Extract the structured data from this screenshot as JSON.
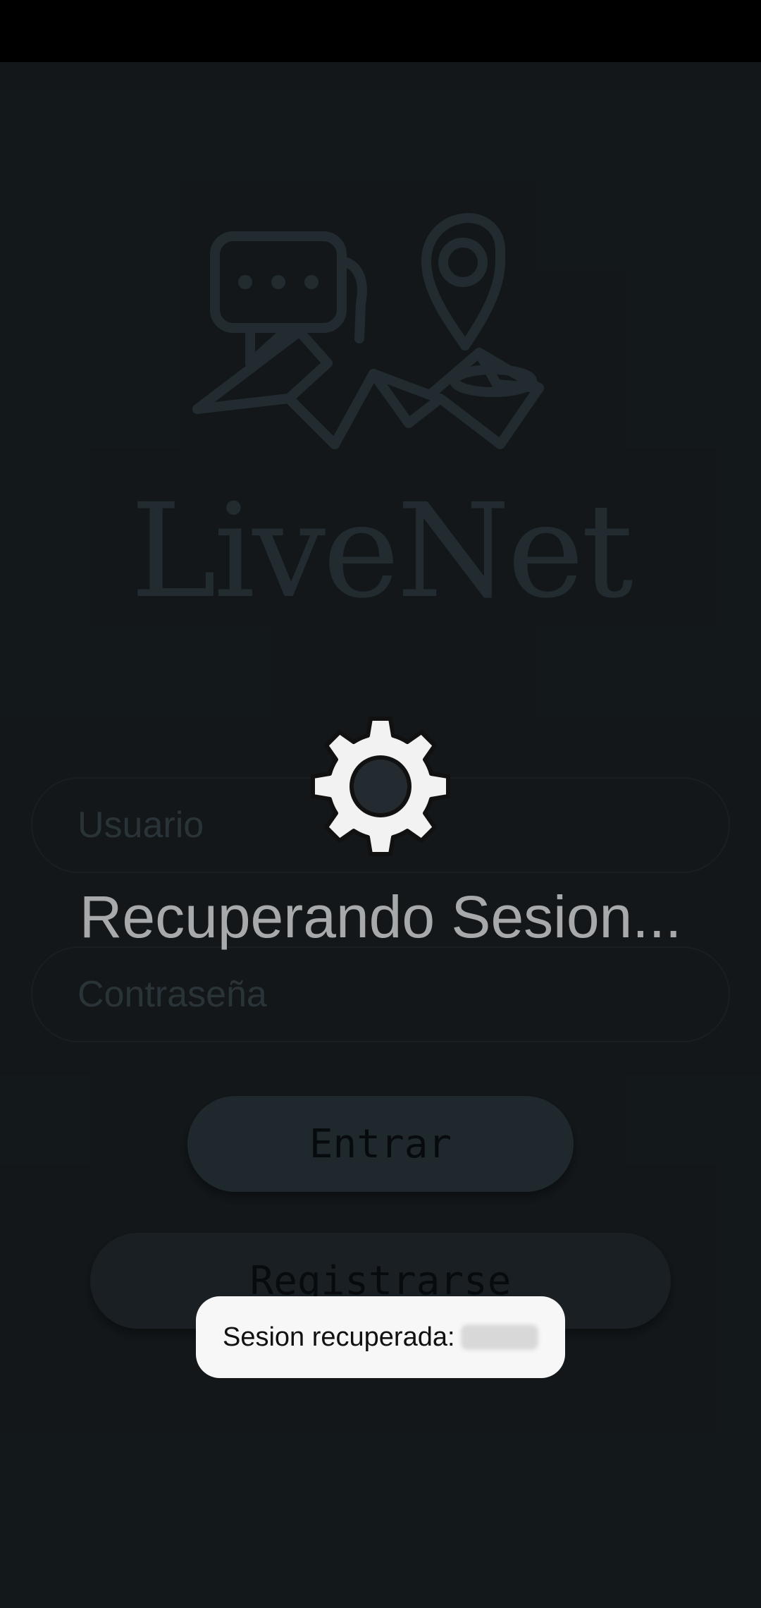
{
  "app": {
    "title": "LiveNet"
  },
  "login": {
    "username_placeholder": "Usuario",
    "password_placeholder": "Contraseña",
    "enter_label": "Entrar",
    "register_label": "Registrarse"
  },
  "loading": {
    "text": "Recuperando Sesion...",
    "icon": "gear-icon"
  },
  "toast": {
    "label": "Sesion recuperada:"
  },
  "colors": {
    "background": "#232b30",
    "logo": "#3e5158",
    "button_enter": "#3a4c53",
    "button_register": "#2f3a3f",
    "toast_bg": "#f7f7f7"
  }
}
